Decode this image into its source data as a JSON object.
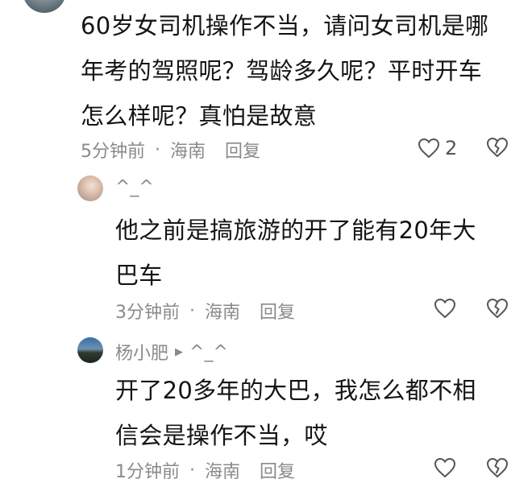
{
  "comments": [
    {
      "text_lines": [
        "60岁女司机操作不当，请问女司机是哪",
        "年考的驾照呢？驾龄多久呢？平时开车",
        "怎么样呢？真怕是故意"
      ],
      "time": "5分钟前",
      "location": "海南",
      "reply_label": "回复",
      "like_count": "2"
    }
  ],
  "replies": [
    {
      "username": "^_^",
      "text_lines": [
        "他之前是搞旅游的开了能有20年大",
        "巴车"
      ],
      "time": "3分钟前",
      "location": "海南",
      "reply_label": "回复"
    },
    {
      "username": "杨小肥",
      "reply_to": "^_^",
      "text_lines": [
        "开了20多年的大巴，我怎么都不相",
        "信会是操作不当，哎"
      ],
      "time": "1分钟前",
      "location": "海南",
      "reply_label": "回复"
    }
  ],
  "separator": "·",
  "icons": {
    "like": "heart-outline-icon",
    "dislike": "broken-heart-icon",
    "reply_arrow": "triangle-right-icon"
  },
  "colors": {
    "meta_text": "#8a8a8a",
    "body_text": "#141414"
  }
}
